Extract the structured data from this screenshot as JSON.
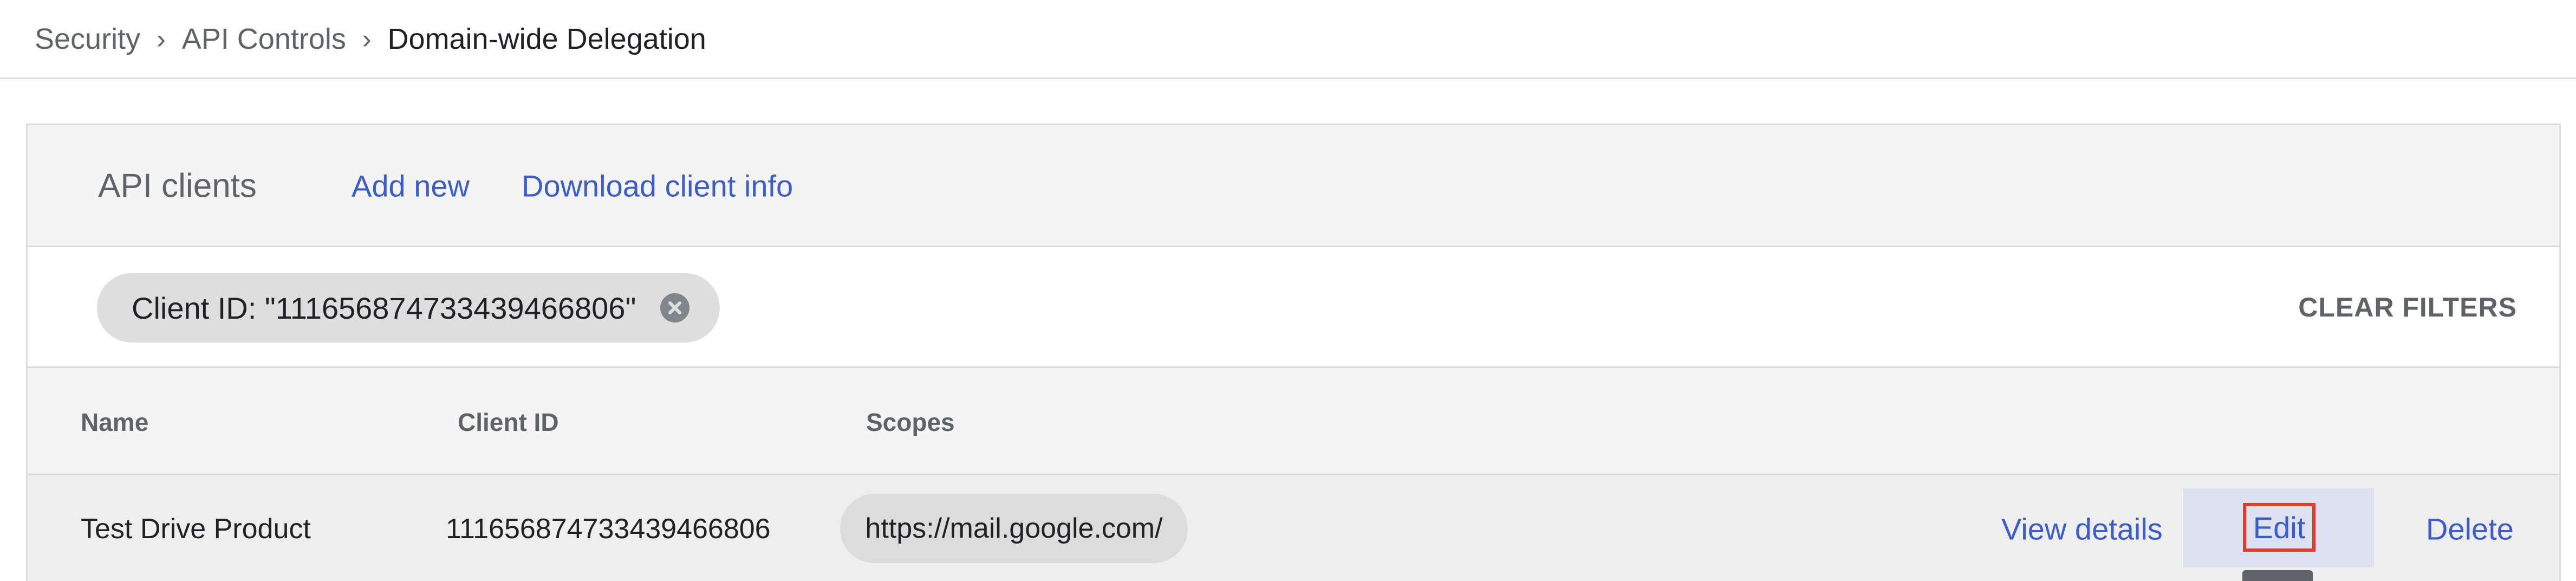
{
  "breadcrumb": {
    "items": [
      "Security",
      "API Controls",
      "Domain-wide Delegation"
    ],
    "separator": "›"
  },
  "header": {
    "title": "API clients",
    "add_new": "Add new",
    "download": "Download client info"
  },
  "filter": {
    "chip_label": "Client ID: \"111656874733439466806\"",
    "clear": "CLEAR FILTERS"
  },
  "table": {
    "columns": [
      "Name",
      "Client ID",
      "Scopes"
    ],
    "rows": [
      {
        "name": "Test Drive Product",
        "client_id": "111656874733439466806",
        "scope": "https://mail.google.com/",
        "actions": {
          "view": "View details",
          "edit": "Edit",
          "delete": "Delete"
        }
      }
    ]
  },
  "colors": {
    "link": "#3b5ccb",
    "highlight": "#e53b2f"
  }
}
